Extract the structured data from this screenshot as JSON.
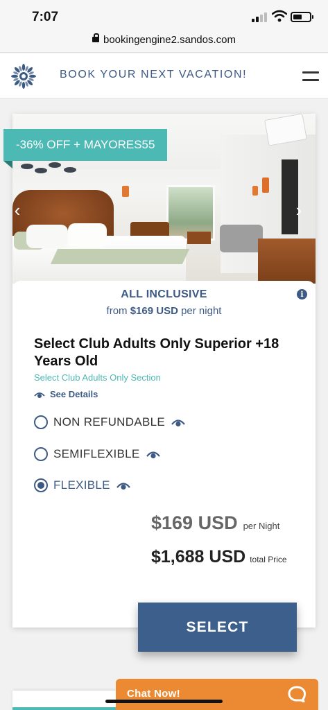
{
  "status_bar": {
    "time": "7:07"
  },
  "browser": {
    "url": "bookingengine2.sandos.com"
  },
  "header": {
    "title": "BOOK YOUR NEXT VACATION!"
  },
  "room": {
    "promo": "-36% OFF + MAYORES55",
    "plan_name": "ALL INCLUSIVE",
    "price_prefix": "from ",
    "price_value": "$169 USD",
    "price_suffix": " per night",
    "title": "Select Club Adults Only Superior +18 Years Old",
    "section": "Select Club Adults Only Section",
    "see_details": "See Details",
    "rate_options": [
      {
        "label": "NON REFUNDABLE",
        "selected": false
      },
      {
        "label": "SEMIFLEXIBLE",
        "selected": false
      },
      {
        "label": "FLEXIBLE",
        "selected": true
      }
    ],
    "night_price": "$169 USD",
    "night_unit": "per Night",
    "total_price": "$1,688 USD",
    "total_unit": "total Price",
    "select_label": "SELECT"
  },
  "chat": {
    "label": "Chat Now!"
  },
  "colors": {
    "brand_blue": "#3d5a84",
    "teal": "#4db9b4",
    "chat_orange": "#ec8a33"
  },
  "icons": [
    "lock-icon",
    "signal-icon",
    "wifi-icon",
    "battery-icon",
    "logo-icon",
    "menu-icon",
    "chevron-left-icon",
    "chevron-right-icon",
    "info-icon",
    "eye-icon",
    "chat-bubble-icon"
  ]
}
